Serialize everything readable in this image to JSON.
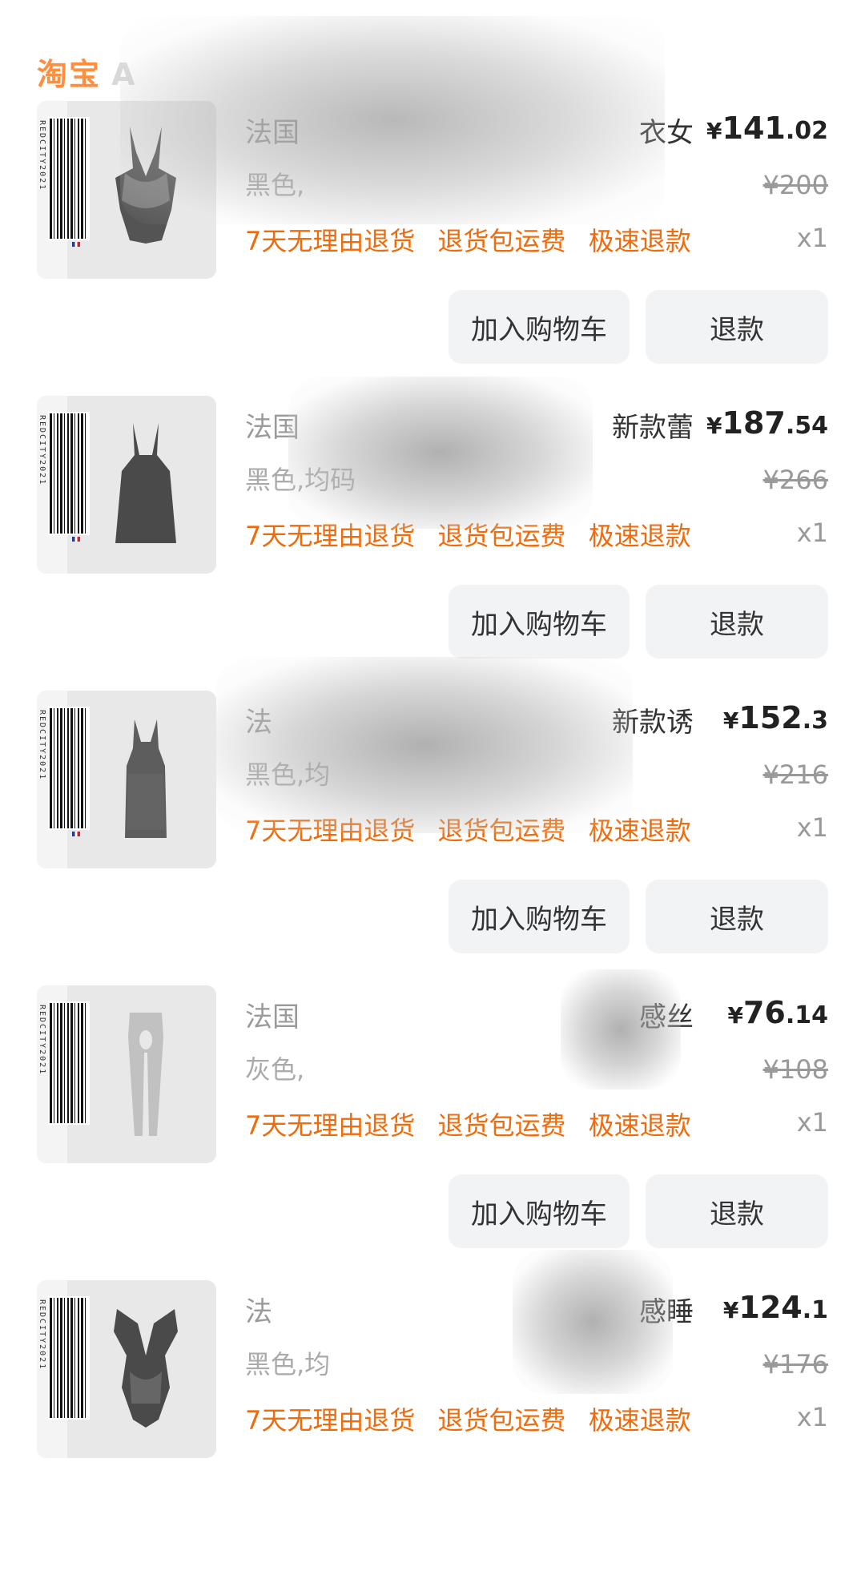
{
  "header": {
    "logo": "淘宝",
    "store_name": "A"
  },
  "common": {
    "services": [
      "7天无理由退货",
      "退货包运费",
      "极速退款"
    ],
    "cart_label": "加入购物车",
    "refund_label": "退款"
  },
  "items": [
    {
      "title_lead": "法国",
      "title_tail": "衣女",
      "variant": "黑色,",
      "price_int": "141",
      "price_cents": ".02",
      "orig_price": "¥200",
      "qty": "x1"
    },
    {
      "title_lead": "法国",
      "title_tail": "新款蕾",
      "variant": "黑色,均码",
      "price_int": "187",
      "price_cents": ".54",
      "orig_price": "¥266",
      "qty": "x1"
    },
    {
      "title_lead": "法",
      "title_tail": "新款诱",
      "variant": "黑色,均",
      "price_int": "152",
      "price_cents": ".3",
      "orig_price": "¥216",
      "qty": "x1"
    },
    {
      "title_lead": "法国",
      "title_tail": "感丝",
      "variant": "灰色,",
      "price_int": "76",
      "price_cents": ".14",
      "orig_price": "¥108",
      "qty": "x1"
    },
    {
      "title_lead": "法",
      "title_tail": "感睡",
      "variant": "黑色,均",
      "price_int": "124",
      "price_cents": ".1",
      "orig_price": "¥176",
      "qty": "x1"
    }
  ],
  "barcode_text": "REDCITY2021",
  "currency_symbol": "¥",
  "colors": {
    "accent": "#f06b0b",
    "button_bg": "#f2f3f5",
    "thumb_bg": "#e8e8e8"
  }
}
